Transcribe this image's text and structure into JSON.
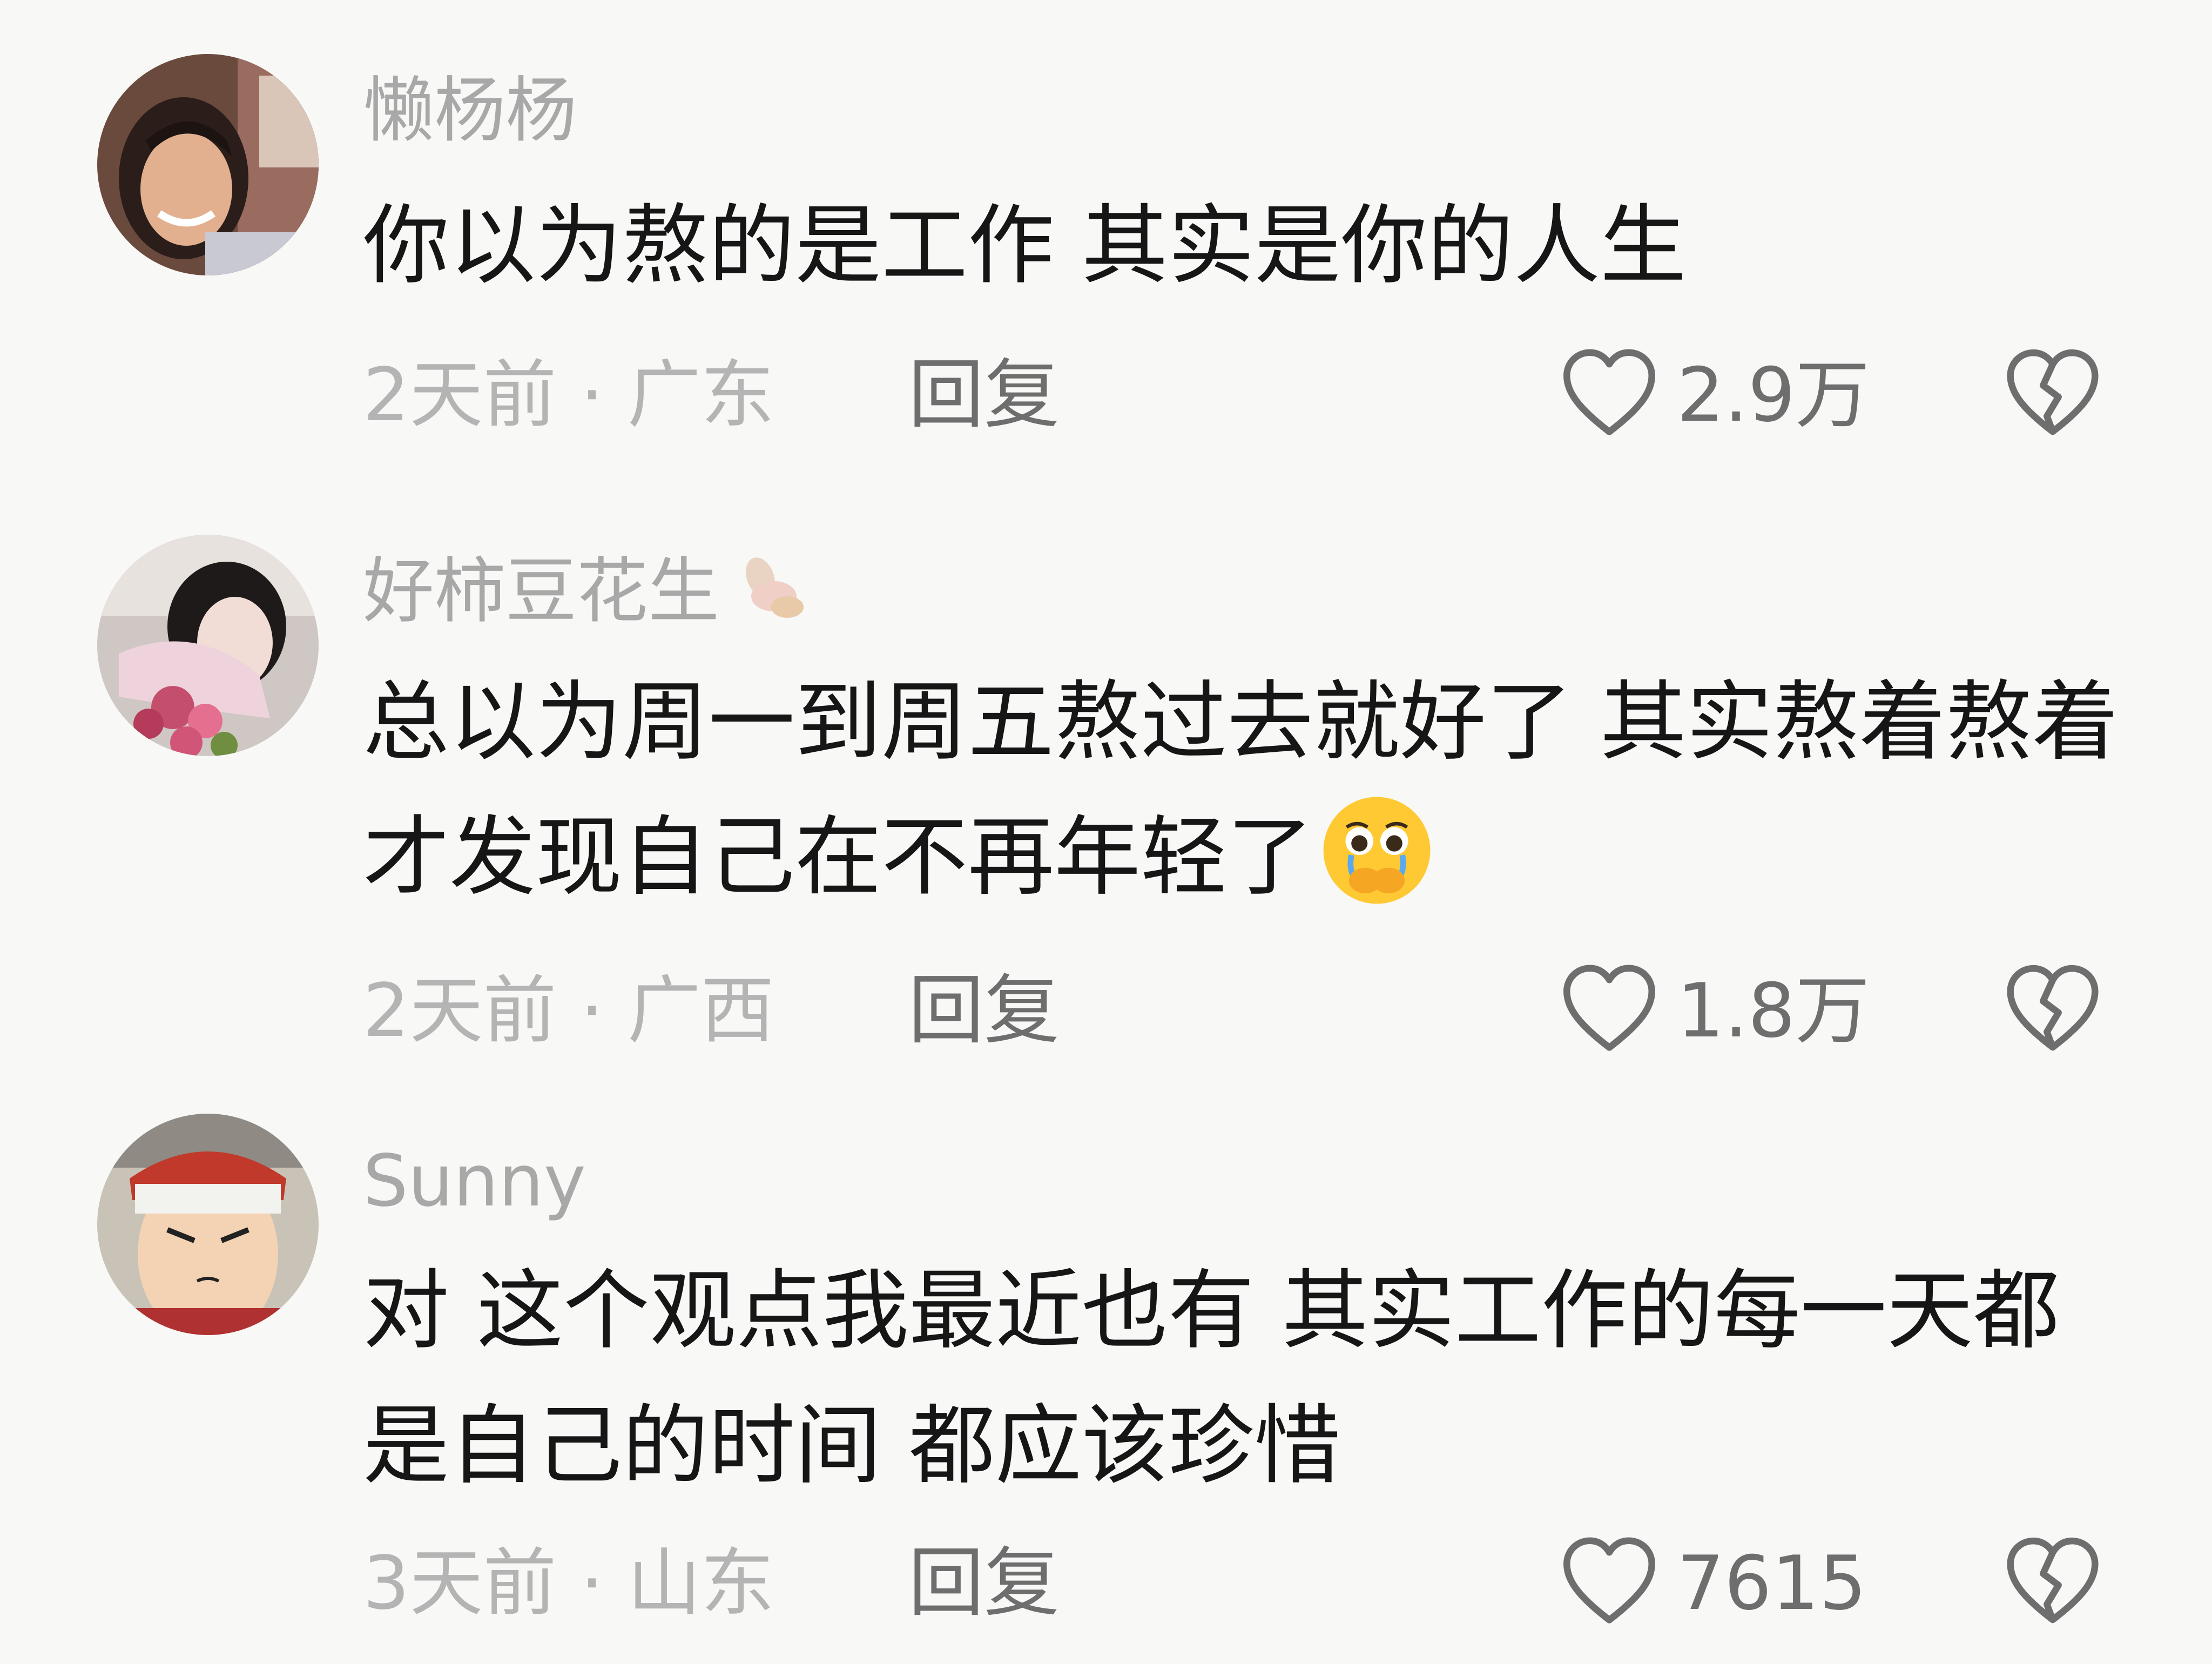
{
  "comments": [
    {
      "username": "懒杨杨",
      "text": "你以为熬的是工作 其实是你的人生",
      "time": "2天前",
      "separator": "·",
      "location": "广东",
      "reply_label": "回复",
      "likes": "2.9万",
      "avatar_icon": "avatar-photo-woman",
      "like_icon": "heart-outline-icon",
      "dislike_icon": "broken-heart-icon"
    },
    {
      "username": "好柿豆花生",
      "username_decoration": "peanut-icon",
      "text": "总以为周一到周五熬过去就好了 其实熬着熬着才发现自己在不再年轻了",
      "text_emoji": "crying-face-emoji",
      "time": "2天前",
      "separator": "·",
      "location": "广西",
      "reply_label": "回复",
      "likes": "1.8万",
      "avatar_icon": "avatar-photo-girl-flowers",
      "like_icon": "heart-outline-icon",
      "dislike_icon": "broken-heart-icon"
    },
    {
      "username": "Sunny",
      "text": "对 这个观点我最近也有 其实工作的每一天都是自己的时间 都应该珍惜",
      "time": "3天前",
      "separator": "·",
      "location": "山东",
      "reply_label": "回复",
      "likes": "7615",
      "avatar_icon": "avatar-anime-character",
      "like_icon": "heart-outline-icon",
      "dislike_icon": "broken-heart-icon"
    }
  ],
  "colors": {
    "background": "#f8f8f6",
    "username": "#a8a8a8",
    "text": "#161616",
    "meta": "#b4b4b4",
    "action": "#6e6e6e"
  }
}
